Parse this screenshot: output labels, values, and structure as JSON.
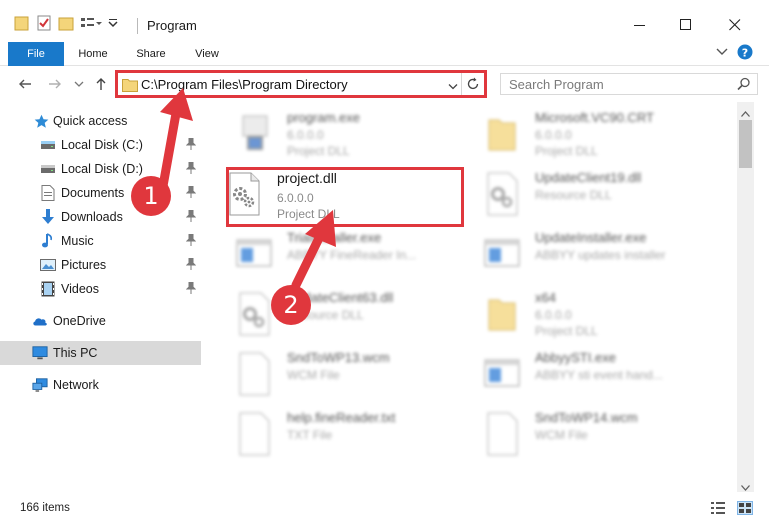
{
  "window": {
    "title": "Program",
    "quick_access_icons": [
      "folder-icon",
      "properties-check-icon",
      "new-folder-icon",
      "customize-dropdown-icon"
    ]
  },
  "ribbon": {
    "tabs": [
      {
        "label": "File",
        "active": true
      },
      {
        "label": "Home"
      },
      {
        "label": "Share"
      },
      {
        "label": "View"
      }
    ]
  },
  "address_bar": {
    "path": "C:\\Program Files\\Program Directory",
    "search_placeholder": "Search Program"
  },
  "sidebar": {
    "quick_access_label": "Quick access",
    "items": [
      {
        "label": "Local Disk (C:)",
        "icon": "drive-icon",
        "pinned": true
      },
      {
        "label": "Local Disk (D:)",
        "icon": "drive-icon",
        "pinned": true
      },
      {
        "label": "Documents",
        "icon": "documents-icon",
        "pinned": true
      },
      {
        "label": "Downloads",
        "icon": "downloads-icon",
        "pinned": true
      },
      {
        "label": "Music",
        "icon": "music-icon",
        "pinned": true
      },
      {
        "label": "Pictures",
        "icon": "pictures-icon",
        "pinned": true
      },
      {
        "label": "Videos",
        "icon": "videos-icon",
        "pinned": true
      }
    ],
    "onedrive_label": "OneDrive",
    "this_pc_label": "This PC",
    "network_label": "Network"
  },
  "files": [
    {
      "name": "program.exe",
      "line2": "6.0.0.0",
      "line3": "Project DLL",
      "icon": "exe-icon",
      "blurred": true
    },
    {
      "name": "Microsoft.VC90.CRT",
      "line2": "6.0.0.0",
      "line3": "Project DLL",
      "icon": "folder-icon",
      "blurred": true
    },
    {
      "name": "project.dll",
      "line2": "6.0.0.0",
      "line3": "Project DLL",
      "icon": "dll-gear-icon",
      "blurred": false
    },
    {
      "name": "UpdateClient19.dll",
      "line2": "Resource DLL",
      "line3": "",
      "icon": "dll-gear-icon",
      "blurred": true
    },
    {
      "name": "TrialInstaller.exe",
      "line2": "ABBYY FineReader In...",
      "line3": "",
      "icon": "app-window-icon",
      "blurred": true
    },
    {
      "name": "UpdateInstaller.exe",
      "line2": "ABBYY updates installer",
      "line3": "",
      "icon": "app-window-icon",
      "blurred": true
    },
    {
      "name": "UpdateClient63.dll",
      "line2": "Resource DLL",
      "line3": "",
      "icon": "dll-gear-icon",
      "blurred": true
    },
    {
      "name": "x64",
      "line2": "6.0.0.0",
      "line3": "Project DLL",
      "icon": "folder-icon",
      "blurred": true
    },
    {
      "name": "SndToWP13.wcm",
      "line2": "WCM File",
      "line3": "",
      "icon": "blank-file-icon",
      "blurred": true
    },
    {
      "name": "AbbyySTI.exe",
      "line2": "ABBYY sti event hand...",
      "line3": "",
      "icon": "app-window-icon",
      "blurred": true
    },
    {
      "name": "help.fineReader.txt",
      "line2": "TXT File",
      "line3": "",
      "icon": "blank-file-icon",
      "blurred": true
    },
    {
      "name": "SndToWP14.wcm",
      "line2": "WCM File",
      "line3": "",
      "icon": "blank-file-icon",
      "blurred": true
    }
  ],
  "status": {
    "item_count": "166 items"
  },
  "annotations": [
    {
      "label": "1"
    },
    {
      "label": "2"
    }
  ],
  "colors": {
    "accent": "#1979ca",
    "annotation_red": "#e0373d",
    "selected_bg": "#d9d9d9"
  }
}
